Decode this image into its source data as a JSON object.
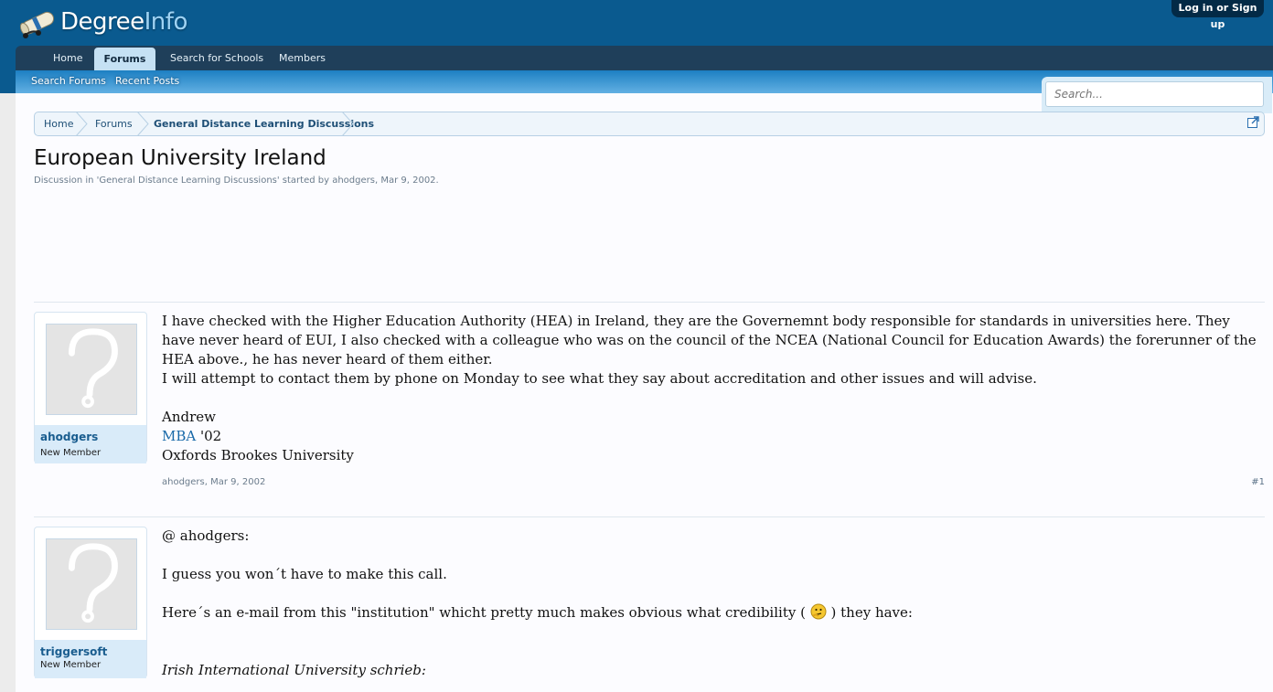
{
  "header": {
    "logo_primary": "Degree",
    "logo_secondary": "Info",
    "login": "Log in or Sign up"
  },
  "nav": {
    "tabs": [
      "Home",
      "Forums",
      "Search for Schools",
      "Members"
    ],
    "active_tab": "Forums",
    "subtabs": [
      "Search Forums",
      "Recent Posts"
    ]
  },
  "search": {
    "placeholder": "Search..."
  },
  "breadcrumb": [
    "Home",
    "Forums",
    "General Distance Learning Discussions"
  ],
  "thread": {
    "title": "European University Ireland",
    "byline": "Discussion in 'General Distance Learning Discussions' started by ahodgers, Mar 9, 2002."
  },
  "posts": [
    {
      "username": "ahodgers",
      "user_title": "New Member",
      "paragraphs": [
        "I have checked with the Higher Education Authority (HEA) in Ireland, they are the Governemnt body responsible for standards in universities here. They have never heard of EUI, I also checked with a colleague who was on the council of the NCEA (National Council for Education Awards) the forerunner of the HEA above., he has never heard of them either.",
        "I will attempt to contact them by phone on Monday to see what they say about accreditation and other issues and will advise."
      ],
      "signature": {
        "name": "Andrew",
        "degree_link": "MBA",
        "degree_year": " '02",
        "school": "Oxfords Brookes University"
      },
      "meta_author": "ahodgers",
      "meta_date": "Mar 9, 2002",
      "number": "#1"
    },
    {
      "username": "triggersoft",
      "user_title": "New Member",
      "line1": "@ ahodgers:",
      "line2": "I guess you won´t have to make this call.",
      "line3_before": "Here´s an e-mail from this \"institution\" whicht pretty much makes obvious what credibility (",
      "line3_after": ") they have:",
      "quote_head": "Irish International University schrieb:"
    }
  ],
  "colors": {
    "header": "#0a5a8f",
    "nav": "#1f3f5a",
    "link": "#1768a8",
    "username": "#1a5d8f"
  },
  "icons": [
    "logo-scroll-icon",
    "jump-to-icon",
    "avatar-placeholder-icon",
    "thinking-smilie-icon"
  ]
}
